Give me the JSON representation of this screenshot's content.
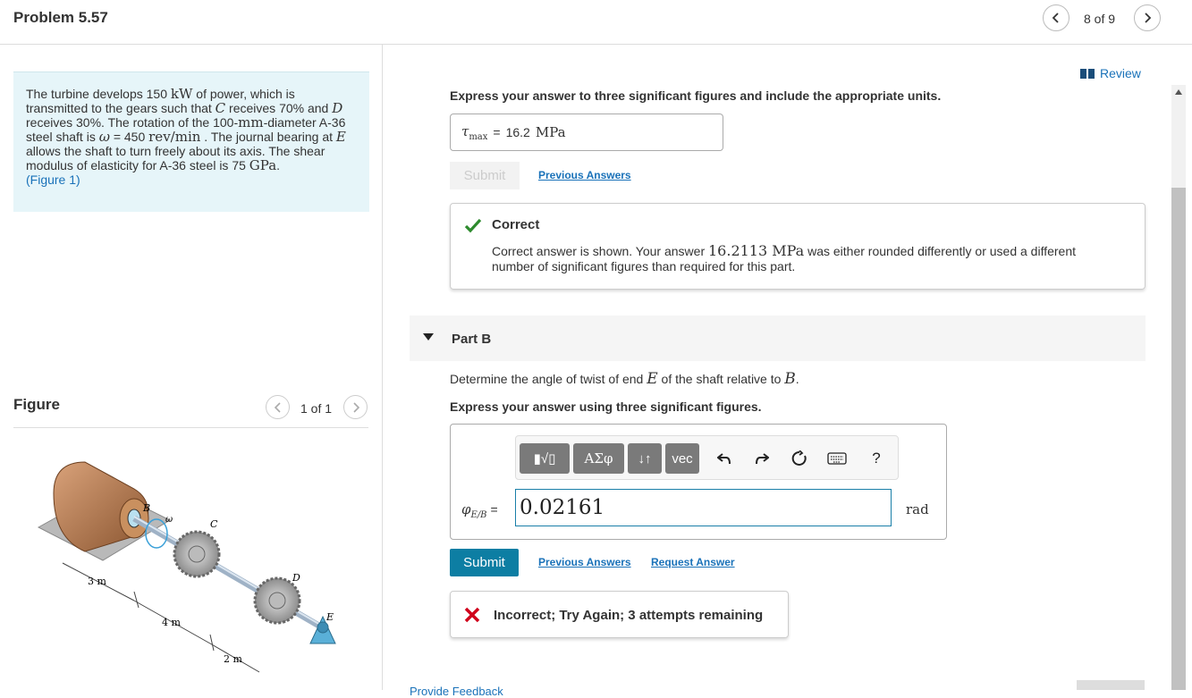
{
  "header": {
    "title": "Problem 5.57",
    "counter": "8 of 9"
  },
  "problem": {
    "t1": "The turbine develops 150 ",
    "kw": "kW",
    "t2": " of power, which is transmitted to the gears such that ",
    "c": "C",
    "t3": " receives 70% and ",
    "d": "D",
    "t4": " receives 30%. The rotation of the 100-",
    "mm": "mm",
    "t5": "-diameter A-36 steel shaft is ",
    "omega": "ω",
    "t6": " = 450  ",
    "revmin": "rev/min",
    "t7": " . The journal bearing at ",
    "e": "E",
    "t8": " allows the shaft to turn freely about its axis. The shear modulus of elasticity for A-36 steel is 75 ",
    "gpa": "GPa",
    "t9": ".",
    "figure_link": "(Figure 1)"
  },
  "figure": {
    "title": "Figure",
    "counter": "1 of 1",
    "labels": {
      "b": "B",
      "omega": "ω",
      "c": "C",
      "d": "D",
      "e": "E",
      "d1": "3 m",
      "d2": "4 m",
      "d3": "2 m"
    }
  },
  "review": "Review",
  "partA": {
    "instruction": "Express your answer to three significant figures and include the appropriate units.",
    "answer_label": "τ",
    "answer_sub": "max",
    "answer_eq": "=",
    "answer_value": "16.2",
    "answer_unit": "MPa",
    "submit": "Submit",
    "previous_answers": "Previous Answers",
    "feedback_title": "Correct",
    "feedback_t1": "Correct answer is shown. Your answer ",
    "feedback_val": "16.2113 MPa",
    "feedback_t2": " was either rounded differently or used a different number of significant figures than required for this part."
  },
  "partB": {
    "label": "Part B",
    "q1": "Determine the angle of twist of end ",
    "e": "E",
    "q2": " of the shaft relative to ",
    "b": "B",
    "q3": ".",
    "instruction": "Express your answer using three significant figures.",
    "toolbar": {
      "templates": "▮√▯",
      "greek": "ΑΣφ",
      "arrows": "↓↑",
      "vec": "vec",
      "help": "?"
    },
    "var": "φ",
    "var_sub": "E/B",
    "eq": "=",
    "value": "0.02161",
    "unit": "rad",
    "submit": "Submit",
    "previous_answers": "Previous Answers",
    "request_answer": "Request Answer",
    "feedback": "Incorrect; Try Again; 3 attempts remaining"
  },
  "footer_cut": "Provide Feedback",
  "colors": {
    "accent": "#0d7ea3",
    "link": "#1a72b9",
    "correct": "#2e8b2e",
    "incorrect": "#d0021b",
    "problem_bg": "#e6f5f9"
  }
}
